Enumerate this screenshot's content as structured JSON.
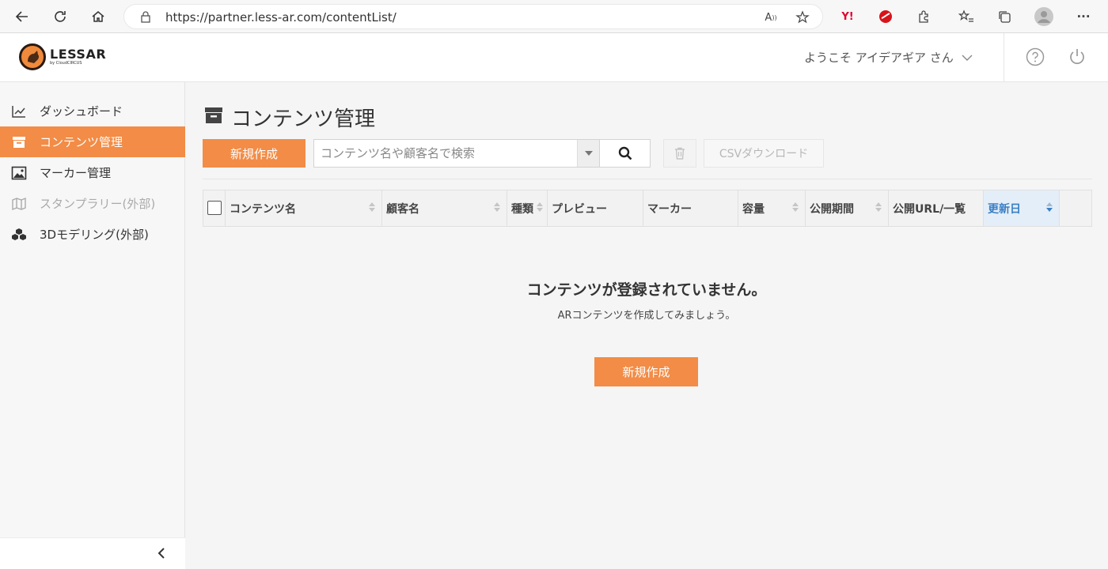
{
  "browser": {
    "url": "https://partner.less-ar.com/contentList/"
  },
  "header": {
    "logo_name": "LESSAR",
    "logo_sub": "by CloudCIRCUS",
    "welcome": "ようこそ アイデアギア さん"
  },
  "sidebar": {
    "items": [
      {
        "label": "ダッシュボード",
        "icon": "line-chart-icon"
      },
      {
        "label": "コンテンツ管理",
        "icon": "archive-box-icon"
      },
      {
        "label": "マーカー管理",
        "icon": "image-icon"
      },
      {
        "label": "スタンプラリー(外部)",
        "icon": "map-icon"
      },
      {
        "label": "3Dモデリング(外部)",
        "icon": "cubes-icon"
      }
    ]
  },
  "main": {
    "title": "コンテンツ管理",
    "new_button": "新規作成",
    "search_placeholder": "コンテンツ名や顧客名で検索",
    "csv_button": "CSVダウンロード",
    "columns": [
      {
        "label": "コンテンツ名"
      },
      {
        "label": "顧客名"
      },
      {
        "label": "種類"
      },
      {
        "label": "プレビュー"
      },
      {
        "label": "マーカー"
      },
      {
        "label": "容量"
      },
      {
        "label": "公開期間"
      },
      {
        "label": "公開URL/一覧"
      },
      {
        "label": "更新日"
      }
    ],
    "empty_title": "コンテンツが登録されていません。",
    "empty_sub": "ARコンテンツを作成してみましょう。",
    "empty_button": "新規作成"
  },
  "colors": {
    "accent": "#f28c46",
    "sorted_header": "#3a7fc4"
  }
}
